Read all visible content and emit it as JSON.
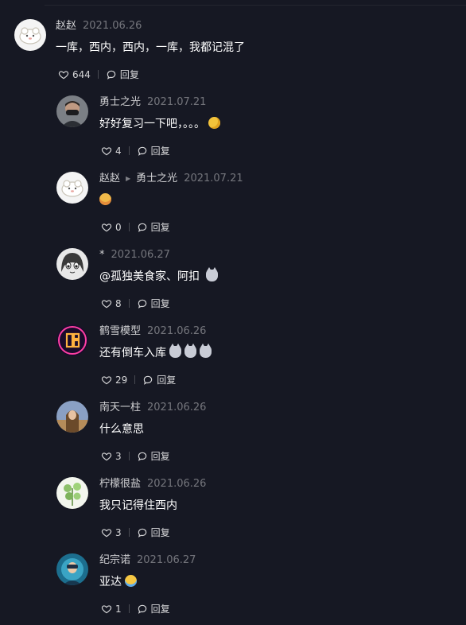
{
  "comments": [
    {
      "author": "赵赵",
      "date": "2021.06.26",
      "text": "一库，西内，西内，一库，我都记混了",
      "likes": "644",
      "reply": "回复",
      "emoji": [],
      "avatar_icon": "cloud-mascot-avatar"
    },
    {
      "author": "勇士之光",
      "date": "2021.07.21",
      "text": "好好复习一下吧，。。。",
      "likes": "4",
      "reply": "回复",
      "emoji": [
        "shy"
      ],
      "avatar_icon": "masked-man-avatar"
    },
    {
      "author": "赵赵",
      "reply_to": "勇士之光",
      "date": "2021.07.21",
      "text": "",
      "likes": "0",
      "reply": "回复",
      "emoji": [
        "face"
      ],
      "avatar_icon": "cloud-mascot-avatar"
    },
    {
      "author": "*",
      "date": "2021.06.27",
      "text": "@孤独美食家、阿扣 ",
      "likes": "8",
      "reply": "回复",
      "emoji": [
        "cat"
      ],
      "avatar_icon": "anime-girl-avatar"
    },
    {
      "author": "鹤雪模型",
      "date": "2021.06.26",
      "text": "还有倒车入库",
      "likes": "29",
      "reply": "回复",
      "emoji": [
        "cat",
        "cat",
        "cat"
      ],
      "avatar_icon": "neon-logo-avatar"
    },
    {
      "author": "南天一柱",
      "date": "2021.06.26",
      "text": "什么意思",
      "likes": "3",
      "reply": "回复",
      "emoji": [],
      "avatar_icon": "girl-photo-avatar"
    },
    {
      "author": "柠檬很盐",
      "date": "2021.06.26",
      "text": "我只记得住西内",
      "likes": "3",
      "reply": "回复",
      "emoji": [],
      "avatar_icon": "plant-avatar"
    },
    {
      "author": "纪宗诺",
      "date": "2021.06.27",
      "text": "亚达",
      "likes": "1",
      "reply": "回复",
      "emoji": [
        "cry"
      ],
      "avatar_icon": "underwater-avatar"
    }
  ],
  "colors": {
    "background": "#161823",
    "text": "#ffffff",
    "meta": "rgba(255,255,255,0.40)"
  }
}
